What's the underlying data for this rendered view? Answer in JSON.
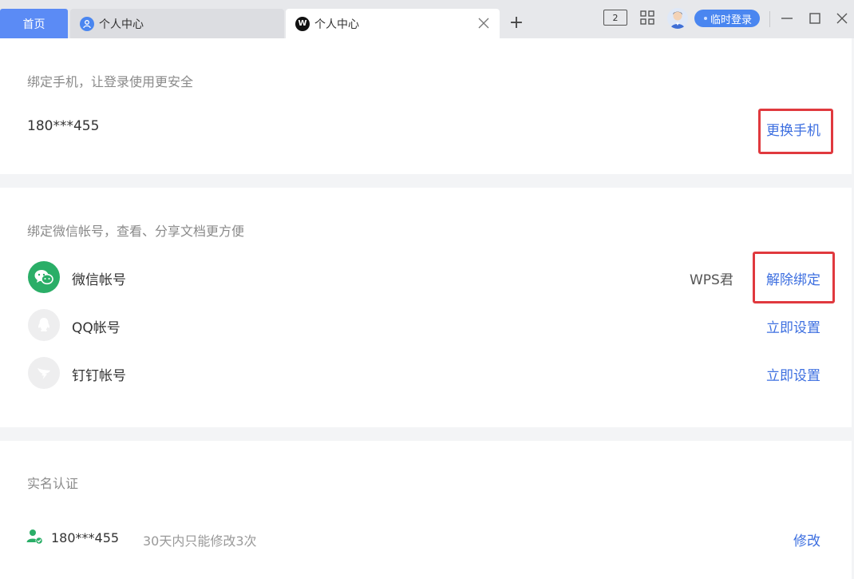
{
  "tabs": {
    "home_label": "首页",
    "tab1_label": "个人中心",
    "tab2_label": "个人中心",
    "wps_glyph": "W",
    "add_glyph": "+"
  },
  "toolbar": {
    "multi_window_count": "2",
    "login_label": "临时登录"
  },
  "phone": {
    "title": "绑定手机，让登录使用更安全",
    "number": "180***455",
    "change_label": "更换手机"
  },
  "bind": {
    "title": "绑定微信帐号，查看、分享文档更方便",
    "accounts": [
      {
        "name": "微信帐号",
        "value": "WPS君",
        "action": "解除绑定",
        "icon": "wechat-icon",
        "color": "#2aae67"
      },
      {
        "name": "QQ帐号",
        "value": "",
        "action": "立即设置",
        "icon": "qq-icon"
      },
      {
        "name": "钉钉帐号",
        "value": "",
        "action": "立即设置",
        "icon": "dingtalk-icon"
      }
    ]
  },
  "realname": {
    "title": "实名认证",
    "number": "180***455",
    "note": "30天内只能修改3次",
    "edit_label": "修改"
  },
  "colors": {
    "accent": "#3d6fe0",
    "home_tab": "#5b8bf5",
    "highlight": "#e0393e",
    "verified": "#2aae67"
  }
}
